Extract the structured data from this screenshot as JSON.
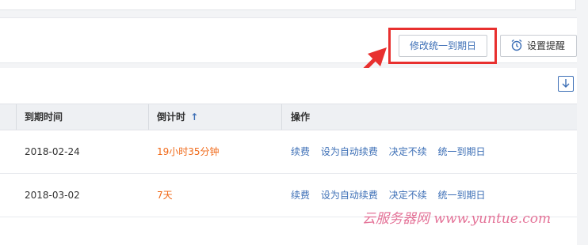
{
  "toolbar": {
    "unify_date_label": "修改统一到期日",
    "reminder_label": "设置提醒"
  },
  "table": {
    "headers": {
      "expiry": "到期时间",
      "countdown": "倒计时",
      "countdown_sort_arrow": "↑",
      "actions": "操作"
    },
    "rows": [
      {
        "expiry": "2018-02-24",
        "countdown": "19小时35分钟",
        "actions": [
          "续费",
          "设为自动续费",
          "决定不续",
          "统一到期日"
        ]
      },
      {
        "expiry": "2018-03-02",
        "countdown": "7天",
        "actions": [
          "续费",
          "设为自动续费",
          "决定不续",
          "统一到期日"
        ]
      }
    ]
  },
  "watermark": "云服务器网 www.yuntue.com",
  "colors": {
    "link": "#3d6fb6",
    "countdown": "#f06a1a",
    "highlight": "#e8302f",
    "watermark": "#e05a86"
  },
  "icons": {
    "reminder": "alarm-clock-icon",
    "download": "download-icon",
    "annotation": "red-arrow"
  }
}
